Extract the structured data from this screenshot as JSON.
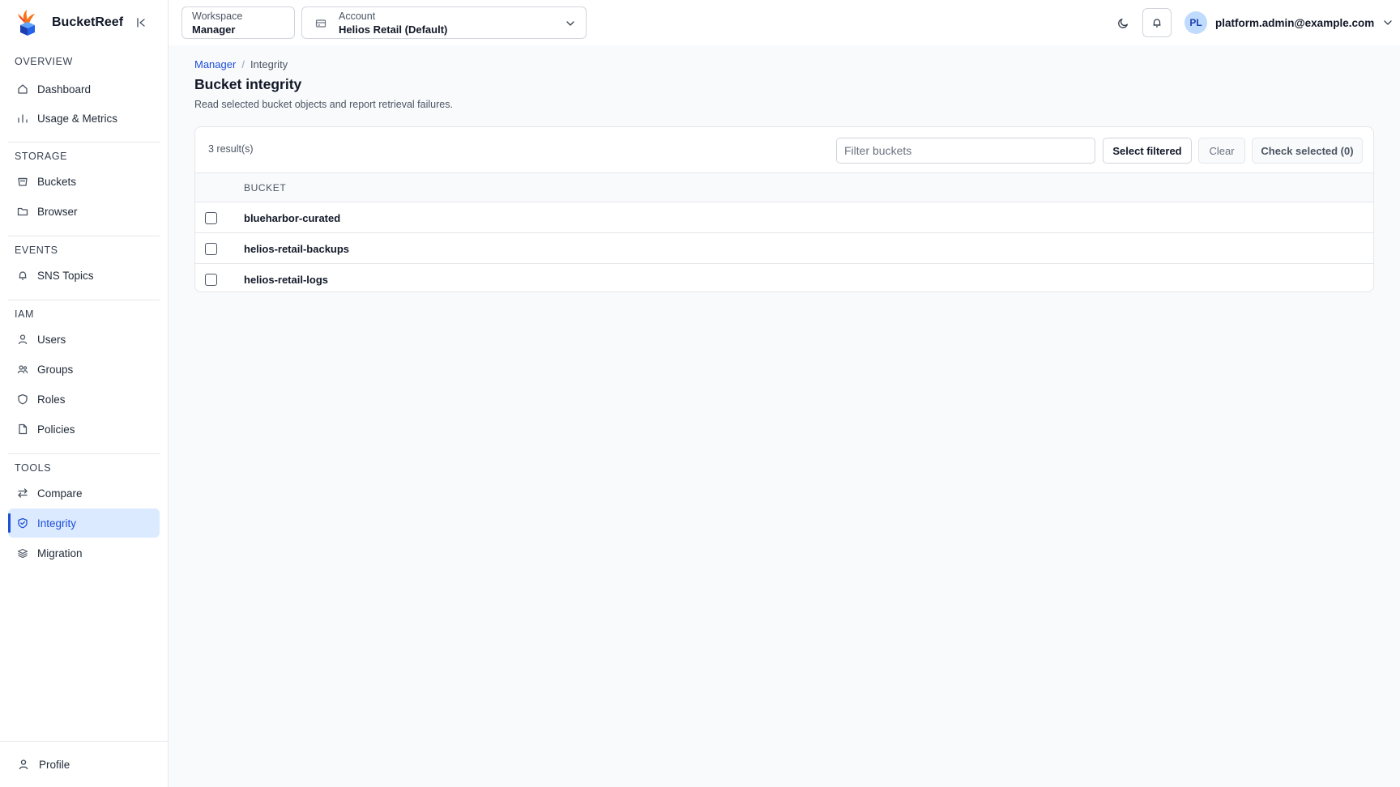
{
  "app": {
    "name": "BucketReef"
  },
  "sidebar": {
    "sections": [
      {
        "title": "OVERVIEW",
        "items": [
          {
            "label": "Dashboard",
            "icon": "home-icon"
          },
          {
            "label": "Usage & Metrics",
            "icon": "bar-chart-icon"
          }
        ]
      },
      {
        "title": "STORAGE",
        "items": [
          {
            "label": "Buckets",
            "icon": "bucket-icon"
          },
          {
            "label": "Browser",
            "icon": "folder-icon"
          }
        ]
      },
      {
        "title": "EVENTS",
        "items": [
          {
            "label": "SNS Topics",
            "icon": "bell-icon"
          }
        ]
      },
      {
        "title": "IAM",
        "items": [
          {
            "label": "Users",
            "icon": "user-icon"
          },
          {
            "label": "Groups",
            "icon": "users-icon"
          },
          {
            "label": "Roles",
            "icon": "shield-icon"
          },
          {
            "label": "Policies",
            "icon": "file-icon"
          }
        ]
      },
      {
        "title": "TOOLS",
        "items": [
          {
            "label": "Compare",
            "icon": "compare-icon"
          },
          {
            "label": "Integrity",
            "icon": "shield-check-icon",
            "active": true
          },
          {
            "label": "Migration",
            "icon": "migration-icon"
          }
        ]
      }
    ],
    "footer": {
      "profile_label": "Profile"
    }
  },
  "topbar": {
    "workspace": {
      "label": "Workspace",
      "value": "Manager"
    },
    "account": {
      "label": "Account",
      "value": "Helios Retail (Default)"
    },
    "user": {
      "initials": "PL",
      "email": "platform.admin@example.com"
    }
  },
  "main": {
    "breadcrumb": {
      "parent": "Manager",
      "separator": "/",
      "current": "Integrity"
    },
    "title": "Bucket integrity",
    "description": "Read selected bucket objects and report retrieval failures.",
    "toolbar": {
      "result_count": "3 result(s)",
      "filter_placeholder": "Filter buckets",
      "select_filtered_label": "Select filtered",
      "clear_label": "Clear",
      "check_selected_label": "Check selected (0)"
    },
    "table": {
      "column_header": "BUCKET",
      "rows": [
        {
          "name": "blueharbor-curated",
          "checked": false
        },
        {
          "name": "helios-retail-backups",
          "checked": false
        },
        {
          "name": "helios-retail-logs",
          "checked": false
        }
      ]
    }
  },
  "colors": {
    "accent": "#1d4ed8",
    "active_bg": "#dbeafe",
    "border": "#e5e7eb",
    "page_bg": "#f8fafc"
  }
}
